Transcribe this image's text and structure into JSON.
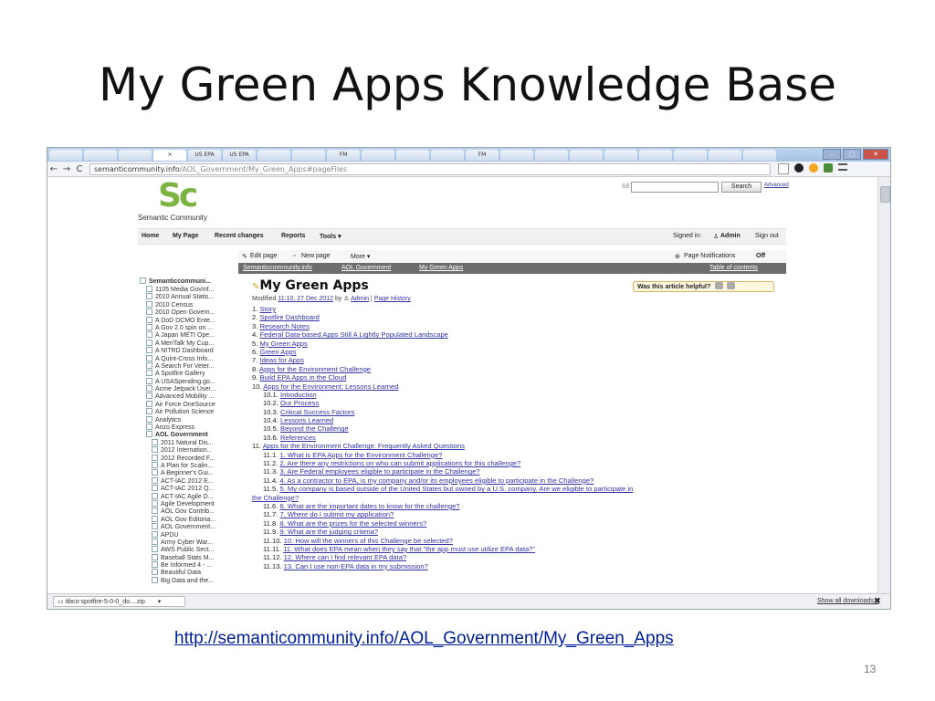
{
  "slide": {
    "title": "My Green Apps Knowledge Base",
    "link": "http://semanticommunity.info/AOL_Government/My_Green_Apps",
    "page_number": "13"
  },
  "browser": {
    "tabs": [
      "",
      "",
      "",
      "×",
      "US EPA",
      "US EPA",
      "",
      "",
      "FM",
      "",
      "",
      "",
      "FM",
      "",
      "",
      "",
      "",
      "",
      "",
      "",
      ""
    ],
    "url_host": "semanticommunity.info",
    "url_path": "/AOL_Government/My_Green_Apps#pageFiles",
    "nav_back": "←",
    "nav_forward": "→",
    "nav_reload": "C"
  },
  "site": {
    "logo": "Sc",
    "logo_text": "Semantic Community",
    "search_label": "SEARCH:",
    "search_button": "Search",
    "advanced_link": "Advanced",
    "nav": {
      "home": "Home",
      "my_page": "My Page",
      "recent_changes": "Recent changes",
      "reports": "Reports",
      "tools": "Tools ▾",
      "signed_in": "Signed in: ",
      "user": "Admin",
      "sign_out": "Sign out"
    }
  },
  "leftnav": {
    "root": "Semanticcommuni...",
    "items": [
      {
        "label": "1105 Media GovInf...",
        "level": 1,
        "bold": false
      },
      {
        "label": "2010 Annual Statis...",
        "level": 1,
        "bold": false
      },
      {
        "label": "2010 Census",
        "level": 1,
        "bold": false
      },
      {
        "label": "2010 Open Govern...",
        "level": 1,
        "bold": false
      },
      {
        "label": "A DoD DCMO Ente...",
        "level": 1,
        "bold": false
      },
      {
        "label": "A Gov 2.0 spin on ...",
        "level": 1,
        "bold": false
      },
      {
        "label": "A Japan METI Ope...",
        "level": 1,
        "bold": false
      },
      {
        "label": "A MeriTalk My Cup...",
        "level": 1,
        "bold": false
      },
      {
        "label": "A NITRD Dashboard",
        "level": 1,
        "bold": false
      },
      {
        "label": "A Quint-Cross Info...",
        "level": 1,
        "bold": false
      },
      {
        "label": "A Search For Veter...",
        "level": 1,
        "bold": false
      },
      {
        "label": "A Spotfire Gallery",
        "level": 1,
        "bold": false
      },
      {
        "label": "A USASpending.go...",
        "level": 1,
        "bold": false
      },
      {
        "label": "Acme Jetpack User...",
        "level": 1,
        "bold": false
      },
      {
        "label": "Advanced Mobility ...",
        "level": 1,
        "bold": false
      },
      {
        "label": "Air Force OneSource",
        "level": 1,
        "bold": false
      },
      {
        "label": "Air Pollution Science",
        "level": 1,
        "bold": false
      },
      {
        "label": "Analytics",
        "level": 1,
        "bold": false
      },
      {
        "label": "Anzo Express",
        "level": 1,
        "bold": false
      },
      {
        "label": "AOL Government",
        "level": 1,
        "bold": true
      },
      {
        "label": "2011 Natural Dis...",
        "level": 2,
        "bold": false
      },
      {
        "label": "2012 Internation...",
        "level": 2,
        "bold": false
      },
      {
        "label": "2012 Recorded F...",
        "level": 2,
        "bold": false
      },
      {
        "label": "A Plan for Scalin...",
        "level": 2,
        "bold": false
      },
      {
        "label": "A Beginner's Gui...",
        "level": 2,
        "bold": false
      },
      {
        "label": "ACT-IAC 2012 E...",
        "level": 2,
        "bold": false
      },
      {
        "label": "ACT-IAC 2012 Q...",
        "level": 2,
        "bold": false
      },
      {
        "label": "ACT-IAC Agile D...",
        "level": 2,
        "bold": false
      },
      {
        "label": "Agile Development",
        "level": 2,
        "bold": false
      },
      {
        "label": "AOL Gov Contrib...",
        "level": 2,
        "bold": false
      },
      {
        "label": "AOL Gov Editoria...",
        "level": 2,
        "bold": false
      },
      {
        "label": "AOL Government...",
        "level": 2,
        "bold": false
      },
      {
        "label": "APDU",
        "level": 2,
        "bold": false
      },
      {
        "label": "Army Cyber War...",
        "level": 2,
        "bold": false
      },
      {
        "label": "AWS Public Sect...",
        "level": 2,
        "bold": false
      },
      {
        "label": "Baseball Stats M...",
        "level": 2,
        "bold": false
      },
      {
        "label": "Be Informed 4 - ...",
        "level": 2,
        "bold": false
      },
      {
        "label": "Beautiful Data",
        "level": 2,
        "bold": false
      },
      {
        "label": "Big Data and the...",
        "level": 2,
        "bold": false
      }
    ]
  },
  "content": {
    "edit_page": "Edit page",
    "new_page": "New page",
    "more": "More ▾",
    "page_notifications": "Page Notifications ",
    "notifications_state": "Off",
    "breadcrumb": [
      "Semanticcommunity.info",
      "AOL Government",
      "My Green Apps"
    ],
    "table_of_contents": "Table of contents",
    "page_title": "My Green Apps",
    "modified_prefix": "Modified ",
    "modified_date": "11:10, 27 Dec 2012",
    "modified_by": " by ",
    "modified_user": "Admin",
    "page_history": "Page History",
    "helpful": "Was this article helpful?",
    "toc": [
      {
        "num": "1.",
        "text": "Story",
        "sub": false
      },
      {
        "num": "2.",
        "text": "Spotfire Dashboard",
        "sub": false
      },
      {
        "num": "3.",
        "text": "Research Notes",
        "sub": false
      },
      {
        "num": "4.",
        "text": "Federal Data-based Apps Still A Lightly Populated Landscape",
        "sub": false
      },
      {
        "num": "5.",
        "text": "My Green Apps",
        "sub": false
      },
      {
        "num": "6.",
        "text": "Green Apps",
        "sub": false
      },
      {
        "num": "7.",
        "text": "Ideas for Apps",
        "sub": false
      },
      {
        "num": "8.",
        "text": "Apps for the Environment Challenge",
        "sub": false
      },
      {
        "num": "9.",
        "text": "Build EPA Apps in the Cloud",
        "sub": false
      },
      {
        "num": "10.",
        "text": "Apps for the Environment: Lessons Learned",
        "sub": false
      },
      {
        "num": "10.1.",
        "text": "Introduction",
        "sub": true
      },
      {
        "num": "10.2.",
        "text": "Our Process",
        "sub": true
      },
      {
        "num": "10.3.",
        "text": "Critical Success Factors",
        "sub": true
      },
      {
        "num": "10.4.",
        "text": "Lessons Learned",
        "sub": true
      },
      {
        "num": "10.5.",
        "text": "Beyond the Challenge",
        "sub": true
      },
      {
        "num": "10.6.",
        "text": "References",
        "sub": true
      },
      {
        "num": "11.",
        "text": "Apps for the Environment Challenge: Frequently Asked Questions",
        "sub": false
      },
      {
        "num": "11.1.",
        "text": "1. What is EPA Apps for the Environment Challenge?",
        "sub": true
      },
      {
        "num": "11.2.",
        "text": "2. Are there any restrictions on who can submit applications for this challenge?",
        "sub": true
      },
      {
        "num": "11.3.",
        "text": "3. Are Federal employees eligible to participate in the Challenge?",
        "sub": true
      },
      {
        "num": "11.4.",
        "text": "4. As a contractor to EPA, is my company and/or its employees eligible to participate in the Challenge?",
        "sub": true
      },
      {
        "num": "11.5.",
        "text": "5. My company is based outside of the United States but owned by a U.S. company. Are we eligible to participate in",
        "sub": true
      },
      {
        "num": "",
        "text": "the Challenge?",
        "sub": false,
        "cont": true
      },
      {
        "num": "11.6.",
        "text": "6. What are the important dates to know for the challenge?",
        "sub": true
      },
      {
        "num": "11.7.",
        "text": "7. Where do I submit my application?",
        "sub": true
      },
      {
        "num": "11.8.",
        "text": "8. What are the prizes for the selected winners?",
        "sub": true
      },
      {
        "num": "11.9.",
        "text": "9. What are the judging criteria?",
        "sub": true
      },
      {
        "num": "11.10.",
        "text": "10. How will the winners of this Challenge be selected?",
        "sub": true
      },
      {
        "num": "11.11.",
        "text": "11. What does EPA mean when they say that \"the app must use utilize EPA data?\"",
        "sub": true
      },
      {
        "num": "11.12.",
        "text": "12. Where can I find relevant EPA data?",
        "sub": true
      },
      {
        "num": "11.13.",
        "text": "13. Can I use non-EPA data in my submission?",
        "sub": true
      }
    ]
  },
  "downloads": {
    "file": "tibco-spotfire-5-0-0_do....zip",
    "show_all": "Show all downloads...",
    "close": "✖"
  }
}
